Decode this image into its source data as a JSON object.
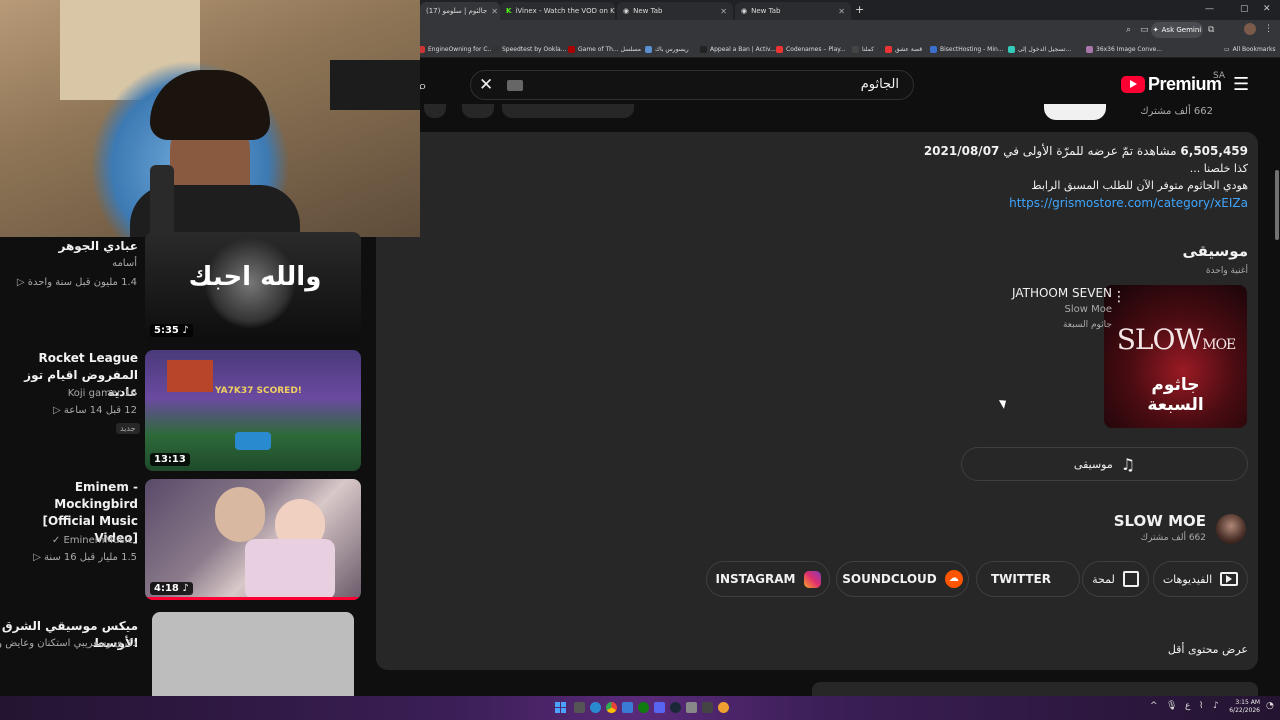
{
  "browser": {
    "tabs": [
      {
        "title": "(17) جالثوم | سلومو"
      },
      {
        "title": "iVinex - Watch the VOD on Kick"
      },
      {
        "title": "New Tab"
      },
      {
        "title": "New Tab"
      }
    ],
    "new_tab_symbol": "+",
    "ask_gemini": "Ask Gemini",
    "bookmarks": [
      "EngineOwning for C...",
      "Speedtest by Ookla...",
      "Game of Th... مسلسل",
      "ريسورس باك",
      "Appeal a Ban | Activ...",
      "Codenames – Play...",
      "كملنا",
      "قصة عشق",
      "BisectHosting - Min...",
      "تسجيل الدخول إلى...",
      "36x36 Image Conve..."
    ],
    "all_bookmarks": "All Bookmarks"
  },
  "youtube": {
    "brand": "Premium",
    "region": "SA",
    "search_value": "الجاثوم",
    "top_subscribers": "662 ألف مشترك"
  },
  "description": {
    "views": "6,505,459",
    "views_label": "مشاهدة",
    "premiere_text": "تمّ عرضه للمرّة الأولى في",
    "date": "2021/08/07",
    "line1": "كذا خلصنا ...",
    "line2": "هودي الجاثوم متوفر الآن للطلب المسبق الرابط",
    "link": "https://grismostore.com/category/xEIZa",
    "music_heading": "موسيقى",
    "music_sub": "أغنية واحدة",
    "song_title": "JATHOOM SEVEN",
    "song_artist": "Slow Moe",
    "song_album": "جاثوم السبعة",
    "music_button": "موسيقى",
    "channel_name": "SLOW MOE",
    "channel_subs": "662 ألف مشترك",
    "links": {
      "videos": "الفيديوهات",
      "about": "لمحة",
      "twitter": "TWITTER",
      "soundcloud": "SOUNDCLOUD",
      "instagram": "INSTAGRAM"
    },
    "show_less": "عرض محتوى أقل"
  },
  "sidebar": {
    "videos": [
      {
        "title": "عبادي الجوهر",
        "channel": "أسامه",
        "meta": "1.4 مليون قبل سنة واحدة",
        "duration": "5:35",
        "thumb_text": "والله احبك"
      },
      {
        "title": "Rocket League المفروض اقيام توز عادية",
        "channel": "Koji gamer 16",
        "meta": "12 قبل 14 ساعة",
        "badge": "جديد",
        "duration": "13:13",
        "thumb_text": "YA7K37 SCORED!"
      },
      {
        "title": "Eminem - Mockingbird [Official Music Video]",
        "channel": "EminemMusic",
        "meta": "1.5 مليار قبل 16 سنة",
        "duration": "4:18"
      },
      {
        "title": "ميكس موسيقي الشرق الأوسط",
        "channel": "ذكرى وسغريبي استكنان وعايض وف..."
      }
    ]
  },
  "taskbar": {
    "time": "3:15 AM",
    "date": "6/22/2026",
    "lang": "ع"
  },
  "colors": {
    "accent_red": "#ff0033",
    "link_blue": "#3ea6ff",
    "panel": "#272727",
    "background": "#0f0f0f"
  }
}
